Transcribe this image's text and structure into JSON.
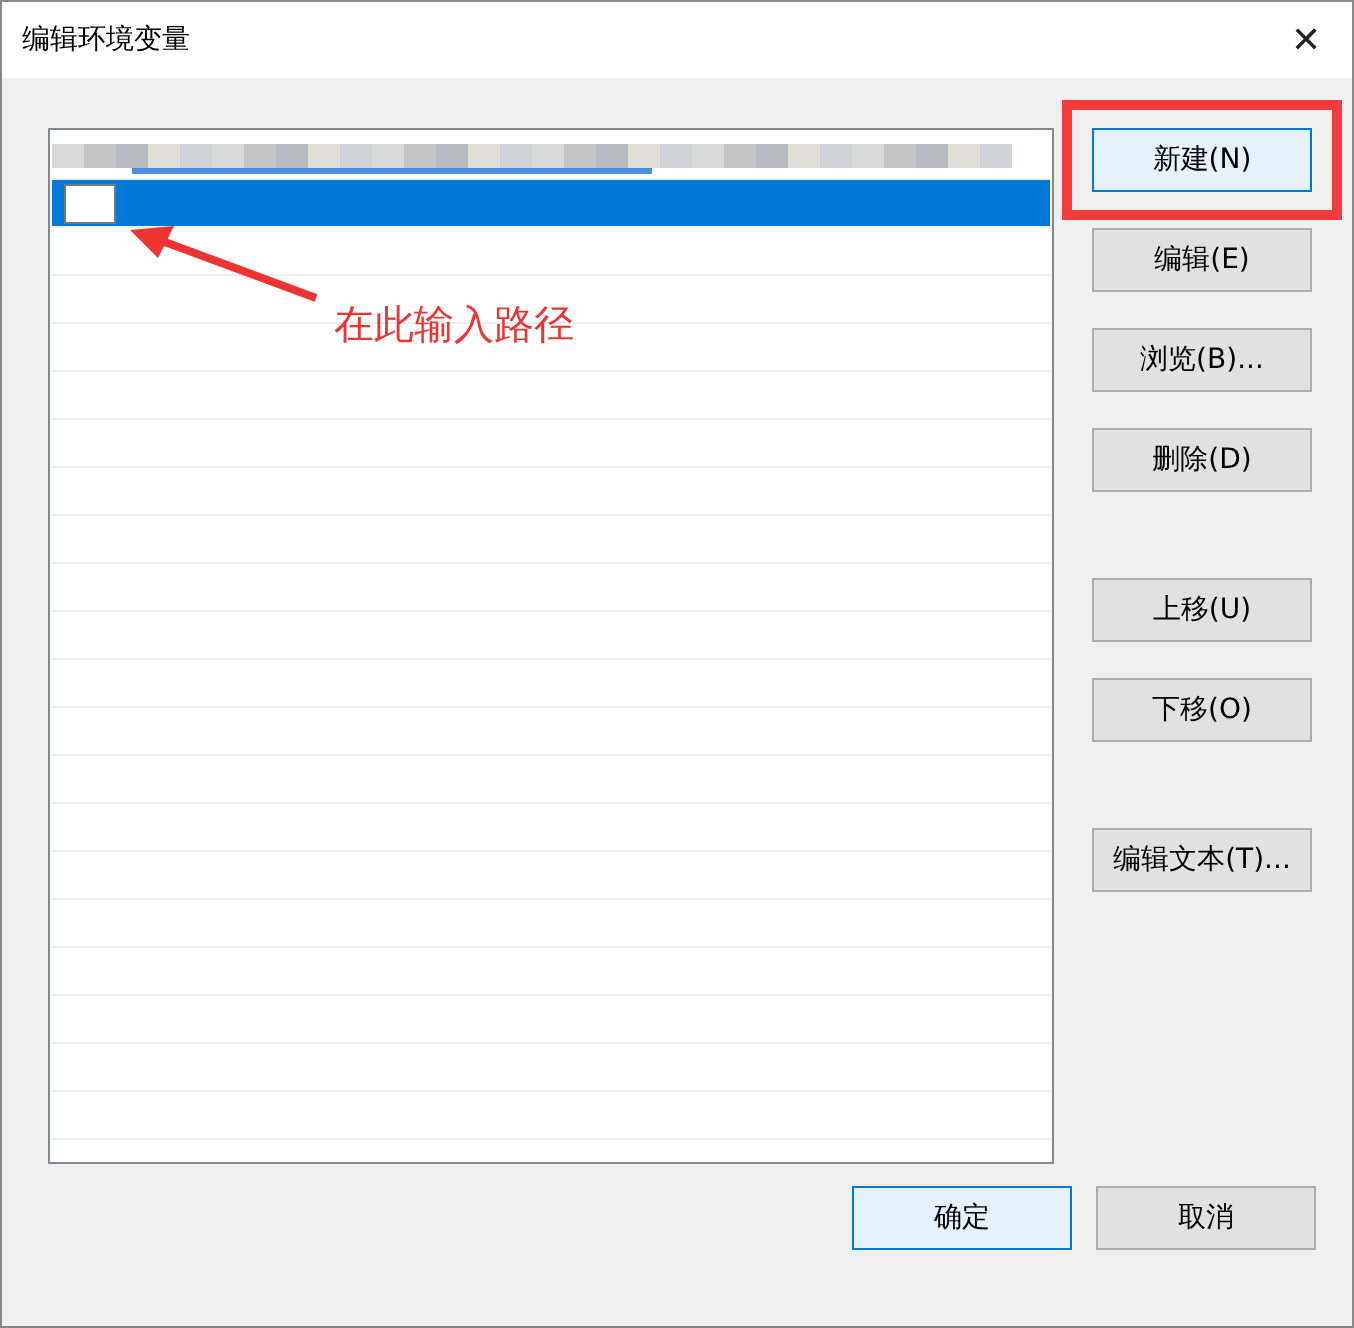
{
  "window": {
    "title": "编辑环境变量",
    "close_glyph": "✕"
  },
  "list": {
    "rows": [
      {
        "kind": "blurred",
        "selected": false
      },
      {
        "kind": "editing",
        "selected": true
      }
    ]
  },
  "annotation": {
    "text": "在此输入路径"
  },
  "side_button_groups": [
    [
      {
        "label": "新建(N)",
        "focused": true,
        "marked": true
      },
      {
        "label": "编辑(E)",
        "focused": false,
        "marked": false
      },
      {
        "label": "浏览(B)...",
        "focused": false,
        "marked": false
      },
      {
        "label": "删除(D)",
        "focused": false,
        "marked": false
      }
    ],
    [
      {
        "label": "上移(U)",
        "focused": false,
        "marked": false
      },
      {
        "label": "下移(O)",
        "focused": false,
        "marked": false
      }
    ],
    [
      {
        "label": "编辑文本(T)...",
        "focused": false,
        "marked": false
      }
    ]
  ],
  "footer_buttons": [
    {
      "label": "确定",
      "focused": true
    },
    {
      "label": "取消",
      "focused": false
    }
  ]
}
